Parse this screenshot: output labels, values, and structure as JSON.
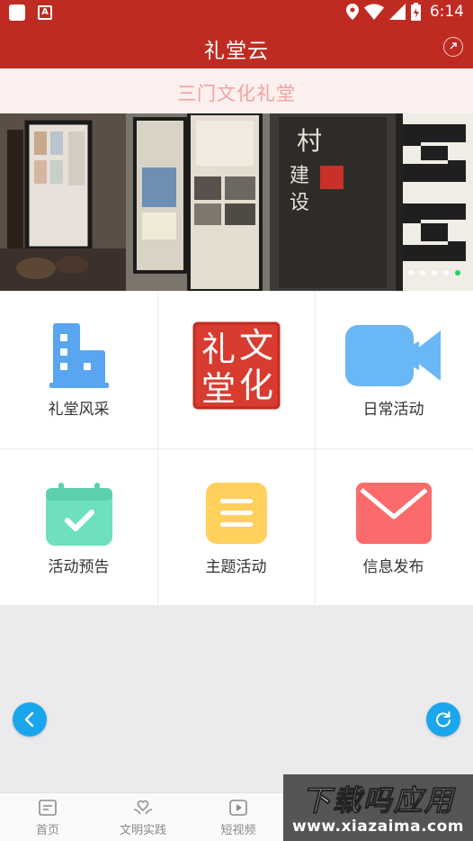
{
  "status_bar": {
    "time": "6:14"
  },
  "app_bar": {
    "title": "礼堂云"
  },
  "subtitle": "三门文化礼堂",
  "banner": {
    "slide_count": 5,
    "active_slide": 5
  },
  "grid": {
    "items": [
      {
        "label": "礼堂风采",
        "icon": "building-icon"
      },
      {
        "label": "",
        "icon": "culture-hall-seal-logo",
        "seal_text": "礼文堂化"
      },
      {
        "label": "日常活动",
        "icon": "video-camera-icon"
      },
      {
        "label": "活动预告",
        "icon": "calendar-check-icon"
      },
      {
        "label": "主题活动",
        "icon": "list-icon"
      },
      {
        "label": "信息发布",
        "icon": "mail-icon"
      }
    ]
  },
  "tab_bar": {
    "tabs": [
      {
        "label": "首页",
        "icon": "home-icon"
      },
      {
        "label": "文明实践",
        "icon": "heart-hands-icon"
      },
      {
        "label": "短视频",
        "icon": "play-icon"
      }
    ]
  },
  "watermark": {
    "main": "下载吗应用",
    "sub": "www.xiazaima.com"
  },
  "colors": {
    "primary": "#bf2b22",
    "subtitle_text": "#f1a2a0",
    "subtitle_bg": "#fbf0ee",
    "fab": "#1aa6ec",
    "building": "#5aa5ef",
    "video": "#6ab7f5",
    "calendar": "#6ee0bf",
    "list": "#ffd05c",
    "mail": "#fb6b6b",
    "seal": "#d83b2f",
    "dot_active": "#1ed760"
  }
}
